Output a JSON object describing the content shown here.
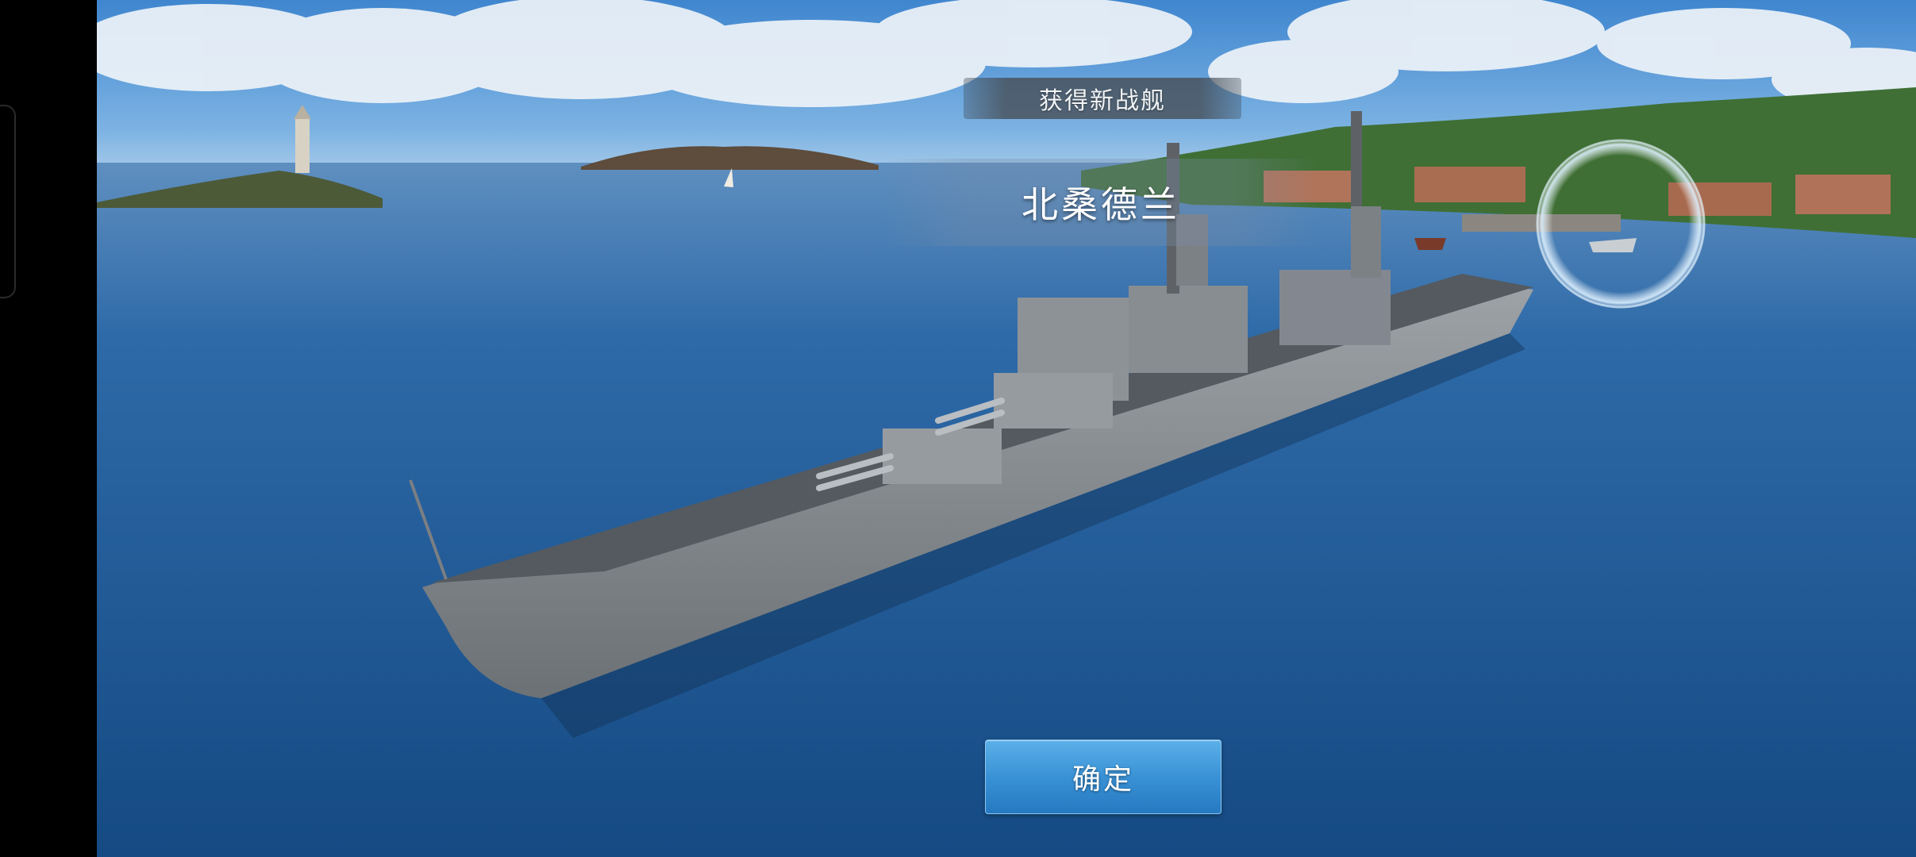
{
  "dialog": {
    "title": "获得新战舰",
    "ship_name": "北桑德兰",
    "confirm_label": "确定"
  },
  "colors": {
    "button_top": "#5bb0e8",
    "button_bottom": "#2579c0",
    "sea": "#1f5b99",
    "sky": "#4b8fd3"
  }
}
